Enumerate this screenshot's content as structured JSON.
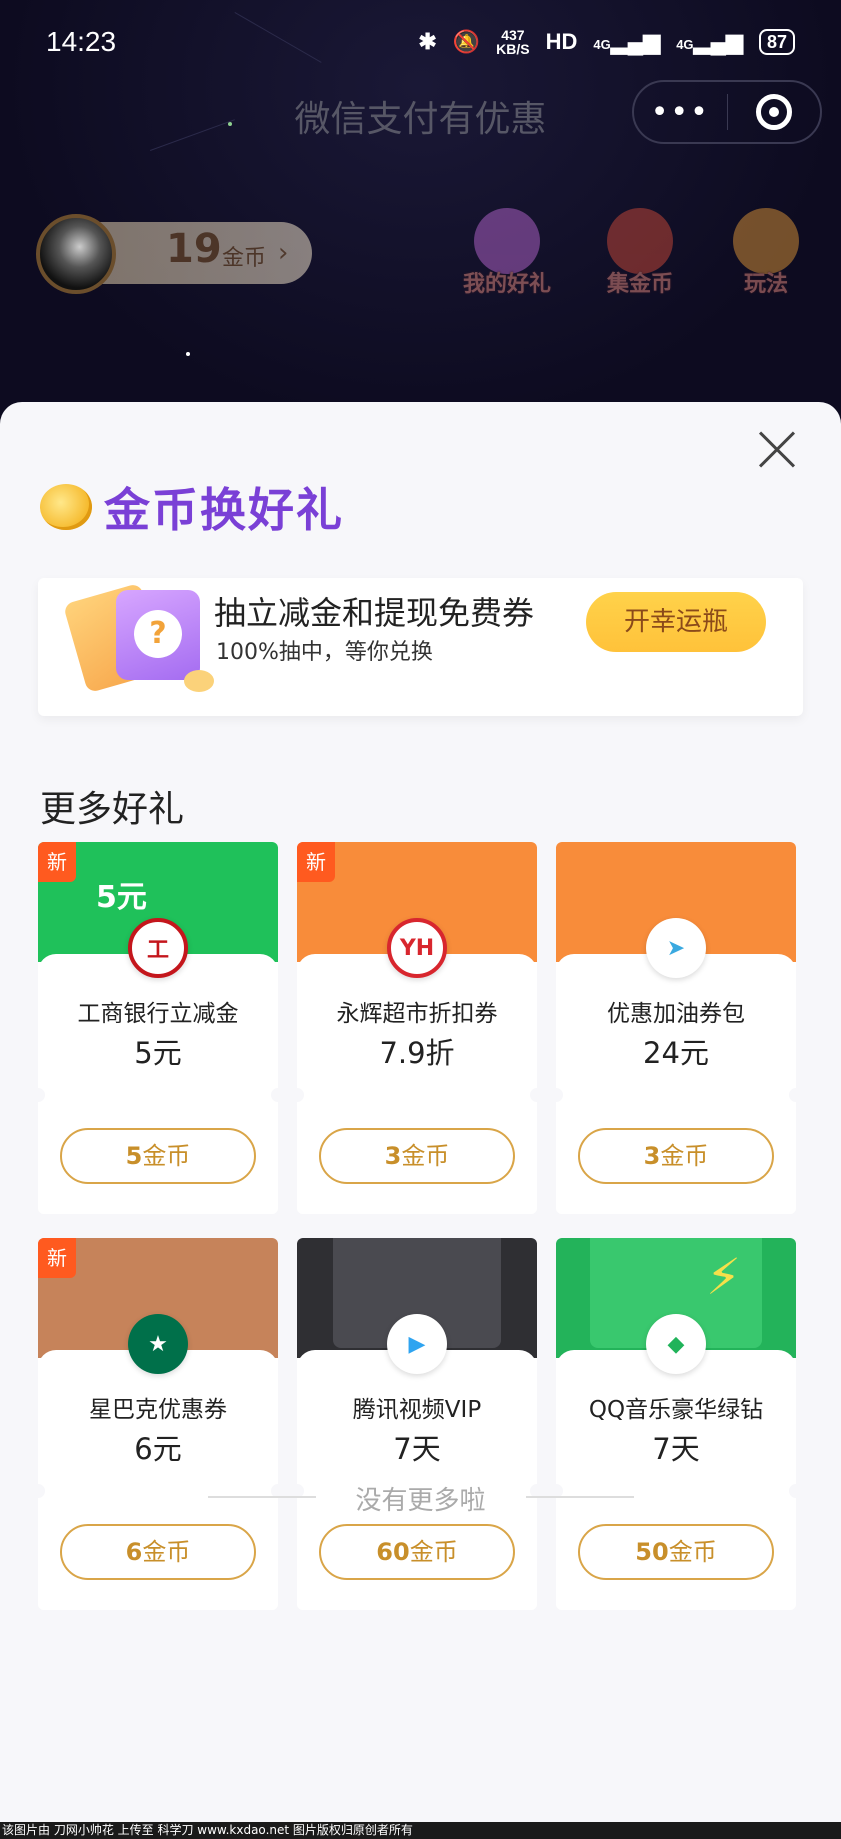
{
  "status": {
    "time": "14:23",
    "speed": "437\nKB/S",
    "net": "HD",
    "signal1": "4G",
    "signal2": "4G",
    "battery": "87"
  },
  "nav": {
    "title": "微信支付有优惠"
  },
  "user": {
    "coins": "19",
    "coin_unit": "金币"
  },
  "top_icons": [
    {
      "label": "我的好礼",
      "color": "#c86fe0"
    },
    {
      "label": "集金币",
      "color": "#e0503a"
    },
    {
      "label": "玩法",
      "color": "#f3a43a"
    }
  ],
  "sheet": {
    "title": "金币换好礼",
    "lucky": {
      "title": "抽立减金和提现免费券",
      "subtitle": "100%抽中，等你兑换",
      "button": "开幸运瓶",
      "qmark": "?"
    },
    "more_title": "更多好礼",
    "new_tag": "新",
    "cards": [
      {
        "name": "工商银行立减金",
        "value": "5元",
        "cost_num": "5",
        "cost_unit": "金币",
        "banner_text": "5元",
        "logo": "工",
        "color": "#1fc15a"
      },
      {
        "name": "永辉超市折扣券",
        "value": "7.9折",
        "cost_num": "3",
        "cost_unit": "金币",
        "logo": "YH",
        "color": "#f88c3a"
      },
      {
        "name": "优惠加油券包",
        "value": "24元",
        "cost_num": "3",
        "cost_unit": "金币",
        "logo": "➤",
        "color": "#f88c3a"
      },
      {
        "name": "星巴克优惠券",
        "value": "6元",
        "cost_num": "6",
        "cost_unit": "金币",
        "logo": "★",
        "color": "#c6835a"
      },
      {
        "name": "腾讯视频VIP",
        "value": "7天",
        "cost_num": "60",
        "cost_unit": "金币",
        "logo": "▶",
        "color": "#2f2f33"
      },
      {
        "name": "QQ音乐豪华绿钻",
        "value": "7天",
        "cost_num": "50",
        "cost_unit": "金币",
        "logo": "◆",
        "color": "#23b35a"
      }
    ],
    "footer": "没有更多啦"
  },
  "watermark": "该图片由 刀网小帅花 上传至 科学刀 www.kxdao.net 图片版权归原创者所有"
}
